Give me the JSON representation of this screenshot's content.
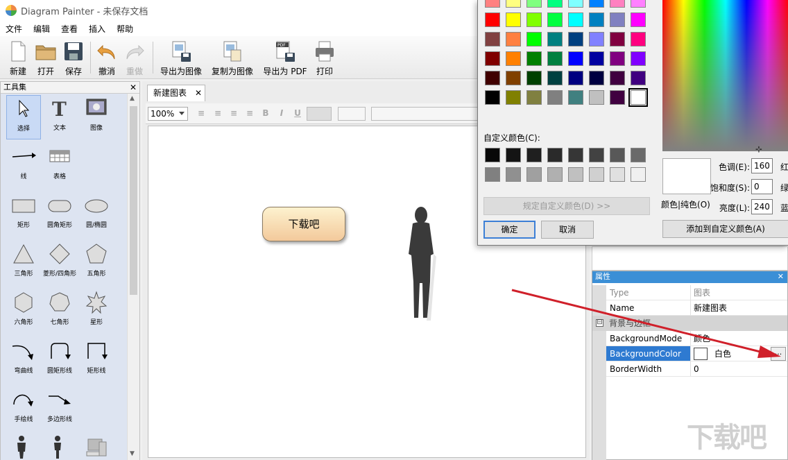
{
  "window": {
    "title": "Diagram Painter - 未保存文档"
  },
  "menu": [
    "文件",
    "编辑",
    "查看",
    "插入",
    "帮助"
  ],
  "toolbar": [
    {
      "label": "新建",
      "icon": "new-document-icon",
      "disabled": false
    },
    {
      "label": "打开",
      "icon": "open-folder-icon",
      "disabled": false
    },
    {
      "label": "保存",
      "icon": "save-disk-icon",
      "disabled": false
    },
    {
      "label": "撤消",
      "icon": "undo-icon",
      "disabled": false
    },
    {
      "label": "重做",
      "icon": "redo-icon",
      "disabled": true
    },
    {
      "label": "导出为图像",
      "icon": "export-image-icon",
      "disabled": false
    },
    {
      "label": "复制为图像",
      "icon": "copy-image-icon",
      "disabled": false
    },
    {
      "label": "导出为 PDF",
      "icon": "export-pdf-icon",
      "disabled": false
    },
    {
      "label": "打印",
      "icon": "printer-icon",
      "disabled": false
    }
  ],
  "pdf_badge": "PDF",
  "toolbox": {
    "title": "工具集",
    "tools": [
      {
        "label": "选择",
        "icon": "select-pointer-icon"
      },
      {
        "label": "文本",
        "icon": "text-tool-icon"
      },
      {
        "label": "图像",
        "icon": "image-tool-icon"
      },
      {
        "label": "线",
        "icon": "line-tool-icon"
      },
      {
        "label": "表格",
        "icon": "table-tool-icon"
      },
      {
        "label": "矩形",
        "icon": "rectangle-icon"
      },
      {
        "label": "圆角矩形",
        "icon": "rounded-rectangle-icon"
      },
      {
        "label": "圆/椭圆",
        "icon": "ellipse-icon"
      },
      {
        "label": "三角形",
        "icon": "triangle-icon"
      },
      {
        "label": "菱形/四角形",
        "icon": "diamond-icon"
      },
      {
        "label": "五角形",
        "icon": "pentagon-icon"
      },
      {
        "label": "六角形",
        "icon": "hexagon-icon"
      },
      {
        "label": "七角形",
        "icon": "heptagon-icon"
      },
      {
        "label": "星形",
        "icon": "star-icon"
      },
      {
        "label": "弯曲线",
        "icon": "curved-line-icon"
      },
      {
        "label": "圆矩形线",
        "icon": "rounded-elbow-line-icon"
      },
      {
        "label": "矩形线",
        "icon": "elbow-line-icon"
      },
      {
        "label": "手绘线",
        "icon": "freehand-line-icon"
      },
      {
        "label": "多边形线",
        "icon": "polyline-icon"
      }
    ]
  },
  "document": {
    "tab_label": "新建图表",
    "zoom": "100%",
    "shape_text": "下载吧"
  },
  "format_buttons": [
    "B",
    "I",
    "U"
  ],
  "properties": {
    "title": "属性",
    "rows": [
      {
        "name": "Type",
        "value": "图表"
      },
      {
        "name": "Name",
        "value": "新建图表"
      }
    ],
    "category": "背景与边框",
    "category_toggle": "⊟",
    "bg_rows": [
      {
        "name": "BackgroundMode",
        "value": "颜色"
      },
      {
        "name": "BackgroundColor",
        "value": "白色"
      },
      {
        "name": "BorderWidth",
        "value": "0"
      }
    ],
    "ellipsis": "..."
  },
  "color_dialog": {
    "basic_colors": [
      "#ff8080",
      "#ffff80",
      "#80ff80",
      "#00ff80",
      "#80ffff",
      "#0080ff",
      "#ff80c0",
      "#ff80ff",
      "#ff0000",
      "#ffff00",
      "#80ff00",
      "#00ff40",
      "#00ffff",
      "#0080c0",
      "#8080c0",
      "#ff00ff",
      "#804040",
      "#ff8040",
      "#00ff00",
      "#008080",
      "#004080",
      "#8080ff",
      "#800040",
      "#ff0080",
      "#800000",
      "#ff8000",
      "#008000",
      "#008040",
      "#0000ff",
      "#0000a0",
      "#800080",
      "#8000ff",
      "#400000",
      "#804000",
      "#004000",
      "#004040",
      "#000080",
      "#000040",
      "#400040",
      "#400080",
      "#000000",
      "#808000",
      "#808040",
      "#808080",
      "#408080",
      "#c0c0c0",
      "#400040",
      "#ffffff"
    ],
    "custom_label": "自定义颜色(C):",
    "custom_colors": [
      "#080808",
      "#141414",
      "#1f1f1f",
      "#2a2a2a",
      "#363636",
      "#424242",
      "#585858",
      "#6a6a6a",
      "#808080",
      "#909090",
      "#a0a0a0",
      "#b0b0b0",
      "#c0c0c0",
      "#d0d0d0",
      "#e0e0e0",
      "#f0f0f0"
    ],
    "define_button": "规定自定义颜色(D) >>",
    "ok": "确定",
    "cancel": "取消",
    "preview_label": "颜色|纯色(O)",
    "hue_label": "色调(E):",
    "hue": "160",
    "sat_label": "饱和度(S):",
    "sat": "0",
    "lum_label": "亮度(L):",
    "lum": "240",
    "red_label": "红",
    "green_label": "绿",
    "blue_label": "蓝",
    "add_button": "添加到自定义颜色(A)"
  },
  "watermark": "下载吧"
}
